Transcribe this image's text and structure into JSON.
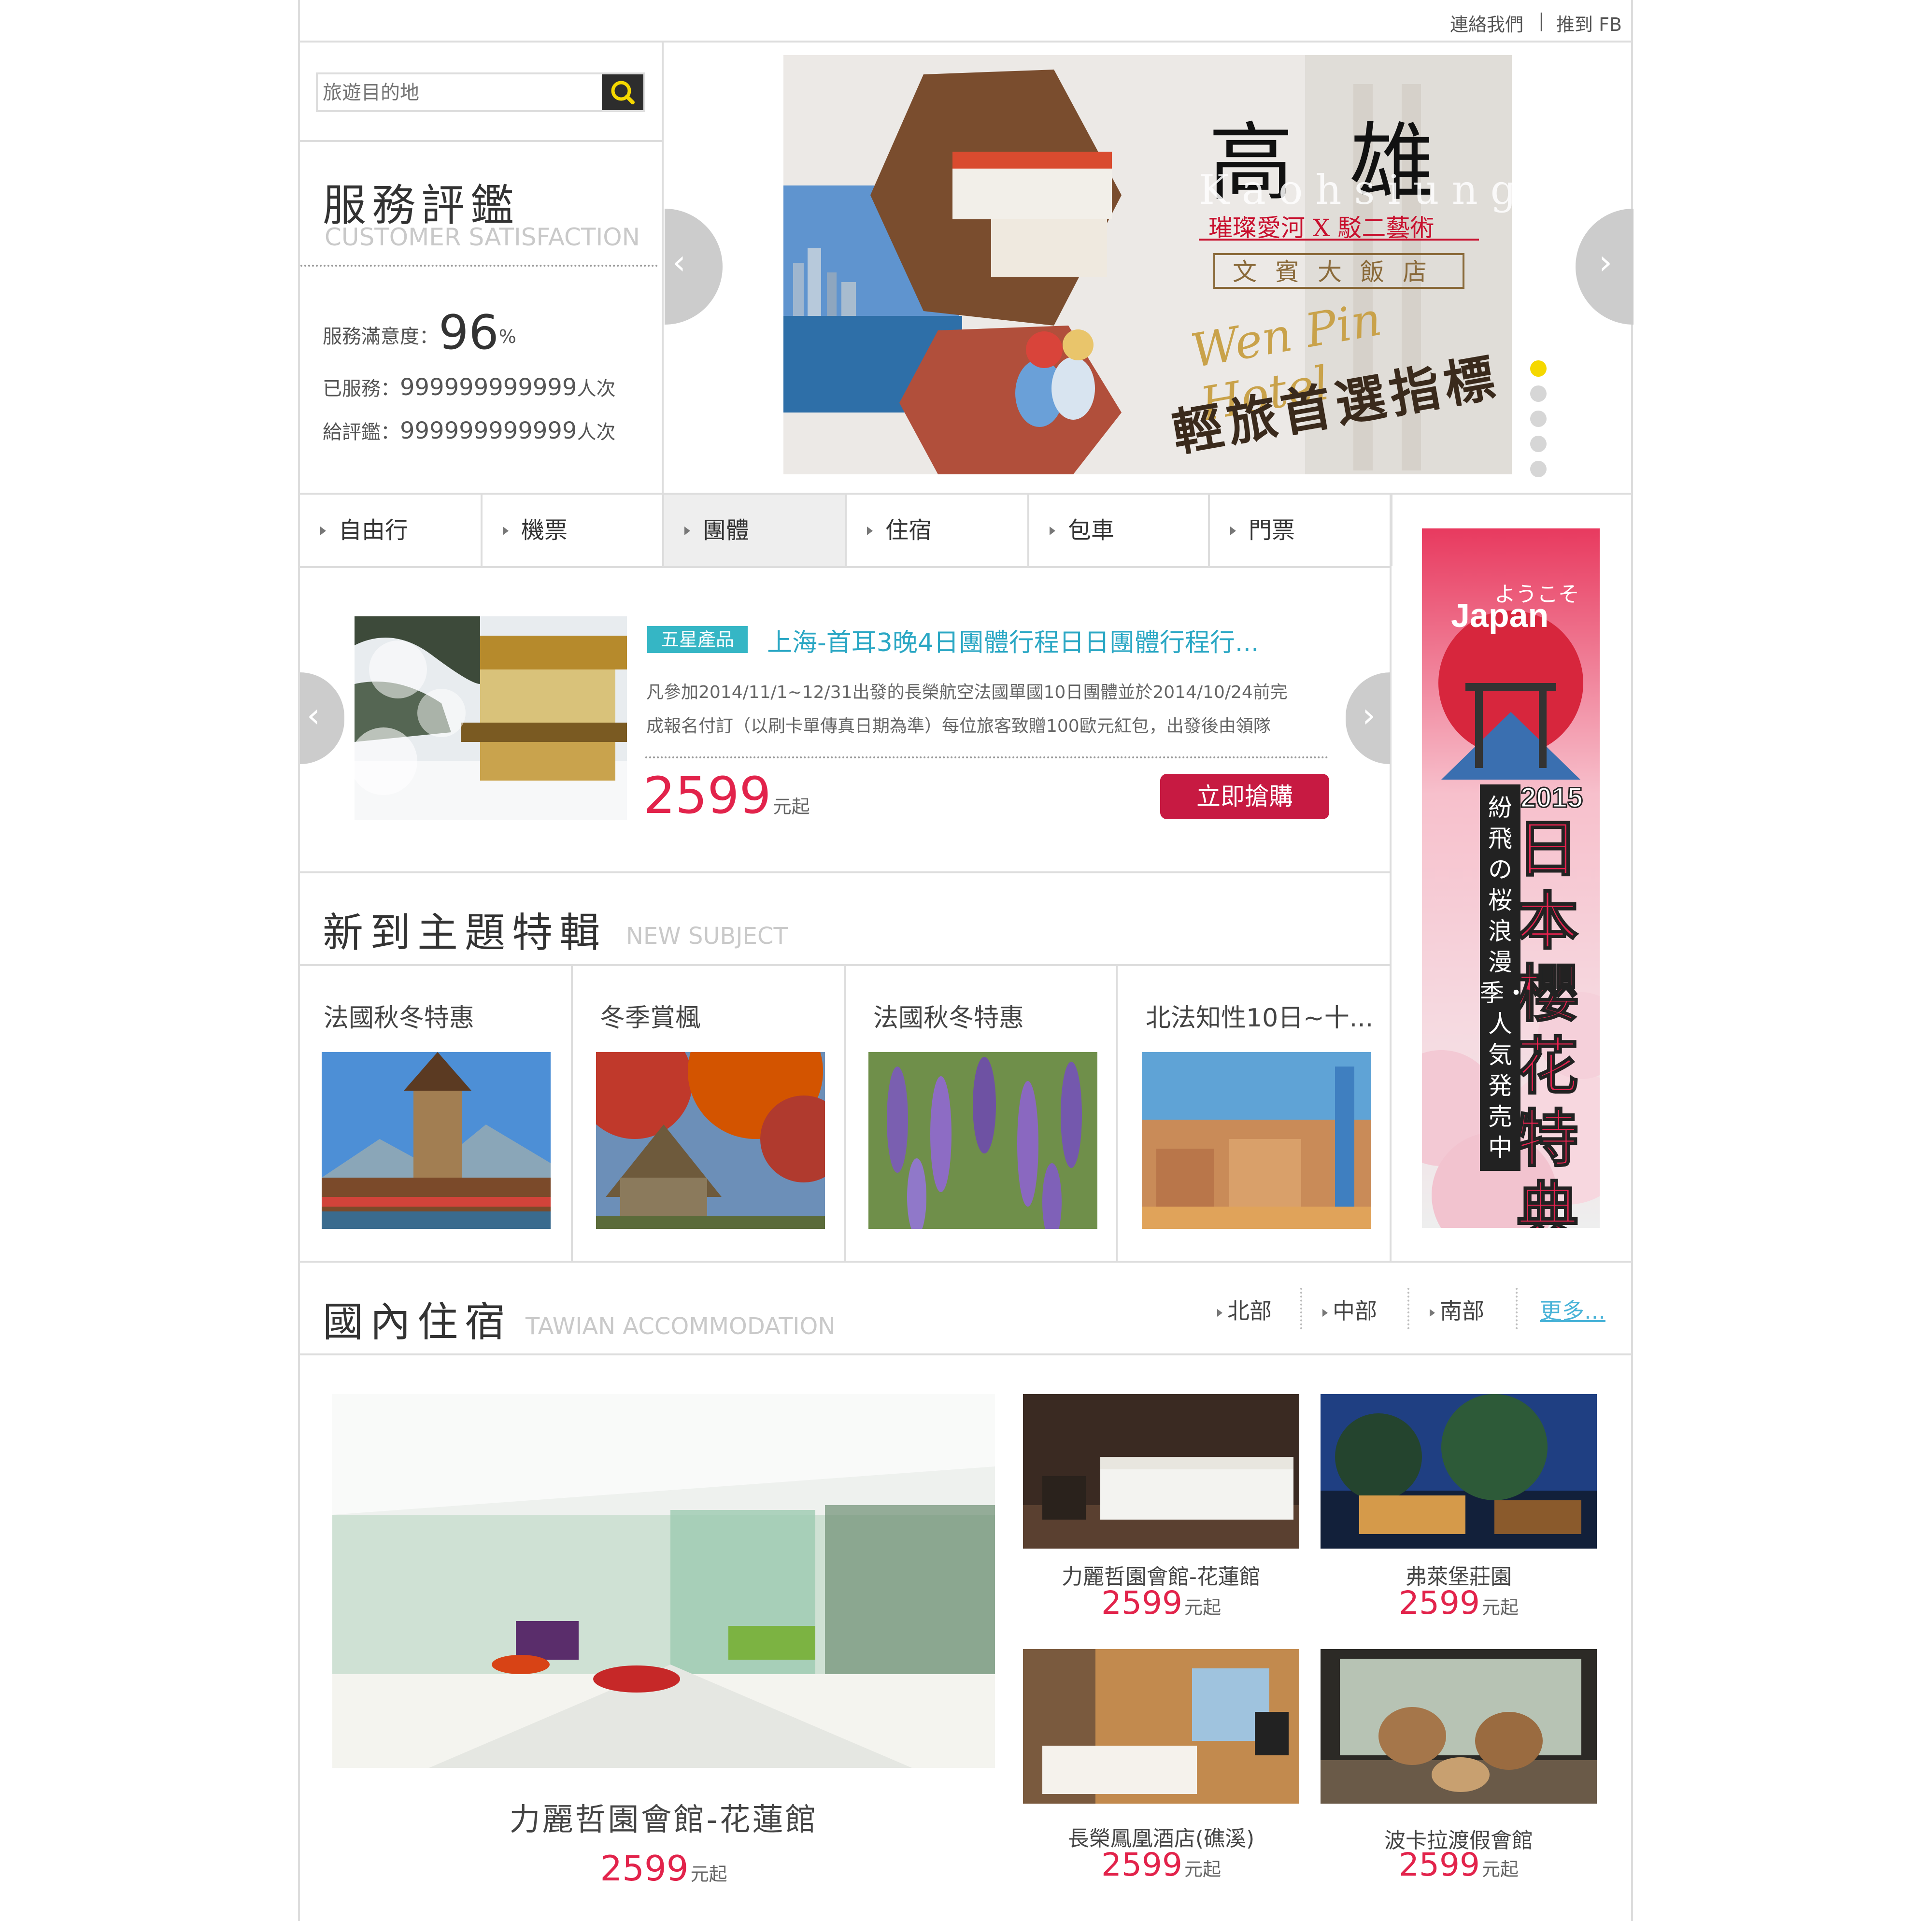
{
  "header": {
    "contact_label": "連絡我們",
    "separator": "|",
    "fb_label": "推到 FB"
  },
  "search": {
    "placeholder": "旅遊目的地"
  },
  "satisfaction": {
    "title": "服務評鑑",
    "subtitle": "CUSTOMER SATISFACTION",
    "rate_label": "服務滿意度：",
    "rate_value": "96",
    "rate_unit": "%",
    "served_label": "已服務：",
    "served_value": "999999999999",
    "served_unit": "人次",
    "reviews_label": "給評鑑：",
    "reviews_value": "999999999999",
    "reviews_unit": "人次"
  },
  "banner": {
    "city": "高 雄",
    "city_en": "Kaohsiung",
    "tagline": "璀璨愛河 X 駁二藝術",
    "hotel_cn": "文賓大飯店",
    "hotel_en": "Wen Pin Hotel",
    "slogan": "輕旅首選指標",
    "slides": [
      {
        "label": "slide-1",
        "active": true
      },
      {
        "label": "slide-2",
        "active": false
      },
      {
        "label": "slide-3",
        "active": false
      },
      {
        "label": "slide-4",
        "active": false
      },
      {
        "label": "slide-5",
        "active": false
      }
    ]
  },
  "tabs": [
    {
      "label": "自由行"
    },
    {
      "label": "機票"
    },
    {
      "label": "團體"
    },
    {
      "label": "住宿"
    },
    {
      "label": "包車"
    },
    {
      "label": "門票"
    }
  ],
  "featured": {
    "badge": "五星產品",
    "title": "上海-首耳3晚4日團體行程日日團體行程行...",
    "desc_line1": "凡參加2014/11/1~12/31出發的長榮航空法國單國10日團體並於2014/10/24前完",
    "desc_line2": "成報名付訂（以刷卡單傳真日期為準）每位旅客致贈100歐元紅包，出發後由領隊",
    "price": "2599",
    "price_unit": "元起",
    "buy_label": "立即搶購"
  },
  "new_subject": {
    "title": "新到主題特輯",
    "subtitle": "NEW SUBJECT",
    "items": [
      {
        "title": "法國秋冬特惠"
      },
      {
        "title": "冬季賞楓"
      },
      {
        "title": "法國秋冬特惠"
      },
      {
        "title": "北法知性10日~十..."
      }
    ]
  },
  "ad": {
    "welcome": "ようこそ",
    "japan": "Japan",
    "year": "2015",
    "headline": "日本櫻花特典",
    "vertical_text": "紛飛の桜浪漫季・人気発売中"
  },
  "accommodation": {
    "title": "國內住宿",
    "subtitle": "TAWIAN ACCOMMODATION",
    "regions": [
      {
        "label": "北部"
      },
      {
        "label": "中部"
      },
      {
        "label": "南部"
      }
    ],
    "more_label": "更多...",
    "main": {
      "name": "力麗哲園會館-花蓮館",
      "price": "2599",
      "unit": "元起"
    },
    "items": [
      {
        "name": "力麗哲園會館-花蓮館",
        "price": "2599",
        "unit": "元起"
      },
      {
        "name": "弗萊堡莊園",
        "price": "2599",
        "unit": "元起"
      },
      {
        "name": "長榮鳳凰酒店(礁溪)",
        "price": "2599",
        "unit": "元起"
      },
      {
        "name": "波卡拉渡假會館",
        "price": "2599",
        "unit": "元起"
      }
    ]
  }
}
